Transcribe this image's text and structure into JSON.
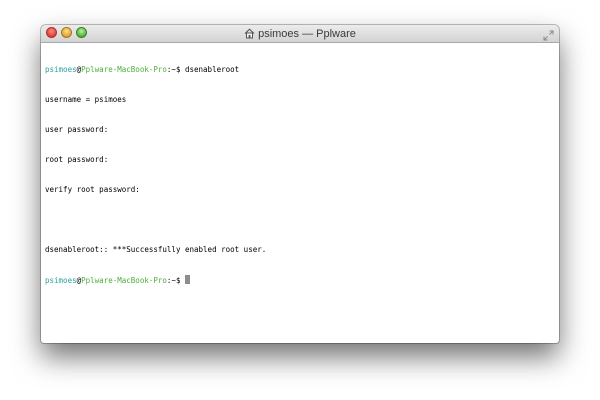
{
  "window": {
    "title": "psimoes — Pplware",
    "title_icon": "home-icon",
    "controls": [
      "close-button",
      "minimize-button",
      "zoom-button"
    ],
    "fullscreen_icon": "fullscreen-icon"
  },
  "terminal": {
    "prompt": {
      "user": "psimoes",
      "at": "@",
      "host": "Pplware-MacBook-Pro",
      "suffix": ":~$ "
    },
    "command": "dsenableroot",
    "output": [
      "username = psimoes",
      "user password:",
      "root password:",
      "verify root password:",
      "",
      "dsenableroot:: ***Successfully enabled root user."
    ]
  },
  "colors": {
    "user": "#2a9e9c",
    "host": "#4caf3a",
    "cursor": "#8c8c8c"
  }
}
